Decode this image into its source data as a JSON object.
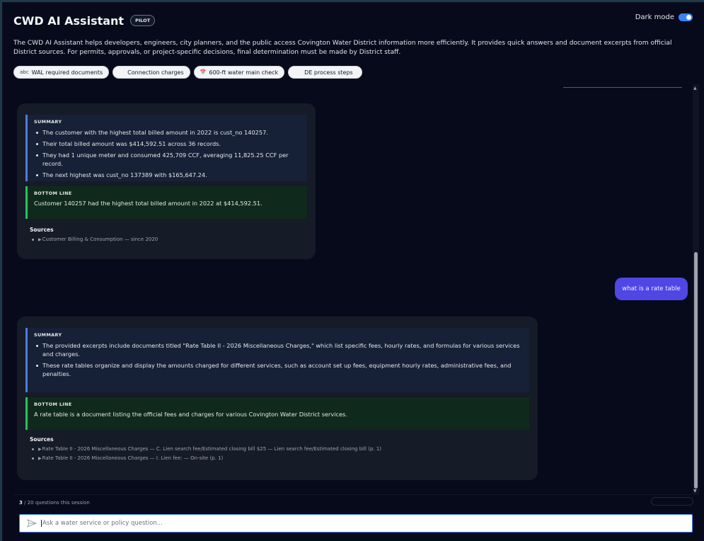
{
  "header": {
    "title": "CWD AI Assistant",
    "badge": "PILOT",
    "dark_mode_label": "Dark mode",
    "dark_mode_on": true
  },
  "description": "The CWD AI Assistant helps developers, engineers, city planners, and the public access Covington Water District information more efficiently. It provides quick answers and document excerpts from official District sources. For permits, approvals, or project-specific decisions, final determination must be made by District staff.",
  "chips": [
    {
      "icon": "abc",
      "label": "WAL required documents"
    },
    {
      "icon": "",
      "label": "Connection charges"
    },
    {
      "icon": "📅",
      "label": "600-ft water main check"
    },
    {
      "icon": "",
      "label": "DE process steps"
    }
  ],
  "messages": {
    "assistant1": {
      "summary_heading": "SUMMARY",
      "summary": [
        "The customer with the highest total billed amount in 2022 is cust_no 140257.",
        "Their total billed amount was $414,592.51 across 36 records.",
        "They had 1 unique meter and consumed 425,709 CCF, averaging 11,825.25 CCF per record.",
        "The next highest was cust_no 137389 with $165,647.24."
      ],
      "bottom_heading": "BOTTOM LINE",
      "bottom_line": "Customer 140257 had the highest total billed amount in 2022 at $414,592.51.",
      "sources_heading": "Sources",
      "sources": [
        "Customer Billing & Consumption — since 2020"
      ]
    },
    "user1": "what is a rate table",
    "assistant2": {
      "summary_heading": "SUMMARY",
      "summary": [
        "The provided excerpts include documents titled \"Rate Table II - 2026 Miscellaneous Charges,\" which list specific fees, hourly rates, and formulas for various services and charges.",
        "These rate tables organize and display the amounts charged for different services, such as account set up fees, equipment hourly rates, administrative fees, and penalties."
      ],
      "bottom_heading": "BOTTOM LINE",
      "bottom_line": "A rate table is a document listing the official fees and charges for various Covington Water District services.",
      "sources_heading": "Sources",
      "sources": [
        "Rate Table II - 2026 Miscellaneous Charges — C. Lien search fee/Estimated closing bill $25 — Lien search fee/Estimated closing bill (p. 1)",
        "Rate Table II - 2026 Miscellaneous Charges — I. Lien fee: — On-site (p. 1)"
      ]
    }
  },
  "footer": {
    "count_used": "3",
    "count_rest": " / 20  questions this session"
  },
  "input": {
    "placeholder": "Ask a water service or policy question..."
  },
  "colors": {
    "accent": "#4f46e5",
    "summary_border": "#4f7cdd",
    "bottom_line_border": "#22c55e"
  }
}
